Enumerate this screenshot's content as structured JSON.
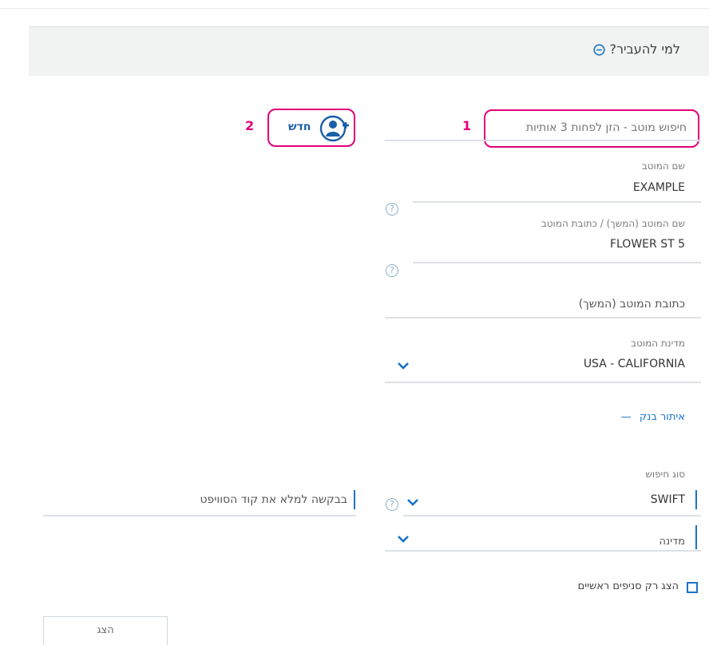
{
  "header": {
    "title": "למי להעביר?"
  },
  "markers": {
    "one": "1",
    "two": "2"
  },
  "search": {
    "placeholder": "חיפוש מוטב - הזן לפחות 3 אותיות"
  },
  "new_button": {
    "label": "חדש"
  },
  "beneficiary_name": {
    "label": "שם המוטב",
    "value": "EXAMPLE"
  },
  "beneficiary_name_cont": {
    "label": "שם המוטב (המשך) / כתובת המוטב",
    "value": "FLOWER ST 5"
  },
  "address_cont": {
    "placeholder": "כתובת המוטב (המשך)"
  },
  "beneficiary_country": {
    "label": "מדינת המוטב",
    "value": "USA - CALIFORNIA"
  },
  "bank_section": {
    "label": "איתור בנק",
    "toggle": "—"
  },
  "search_type": {
    "label": "סוג חיפוש",
    "value": "SWIFT"
  },
  "swift_input": {
    "placeholder": "בבקשה למלא את קוד הסוויפט"
  },
  "country": {
    "placeholder": "מדינה"
  },
  "main_branches": {
    "label": "הצג רק סניפים ראשיים"
  },
  "show_button": {
    "label": "הצג"
  },
  "help": {
    "glyph": "?"
  },
  "colors": {
    "accent": "#1a73c8",
    "highlight": "#e2007a"
  }
}
